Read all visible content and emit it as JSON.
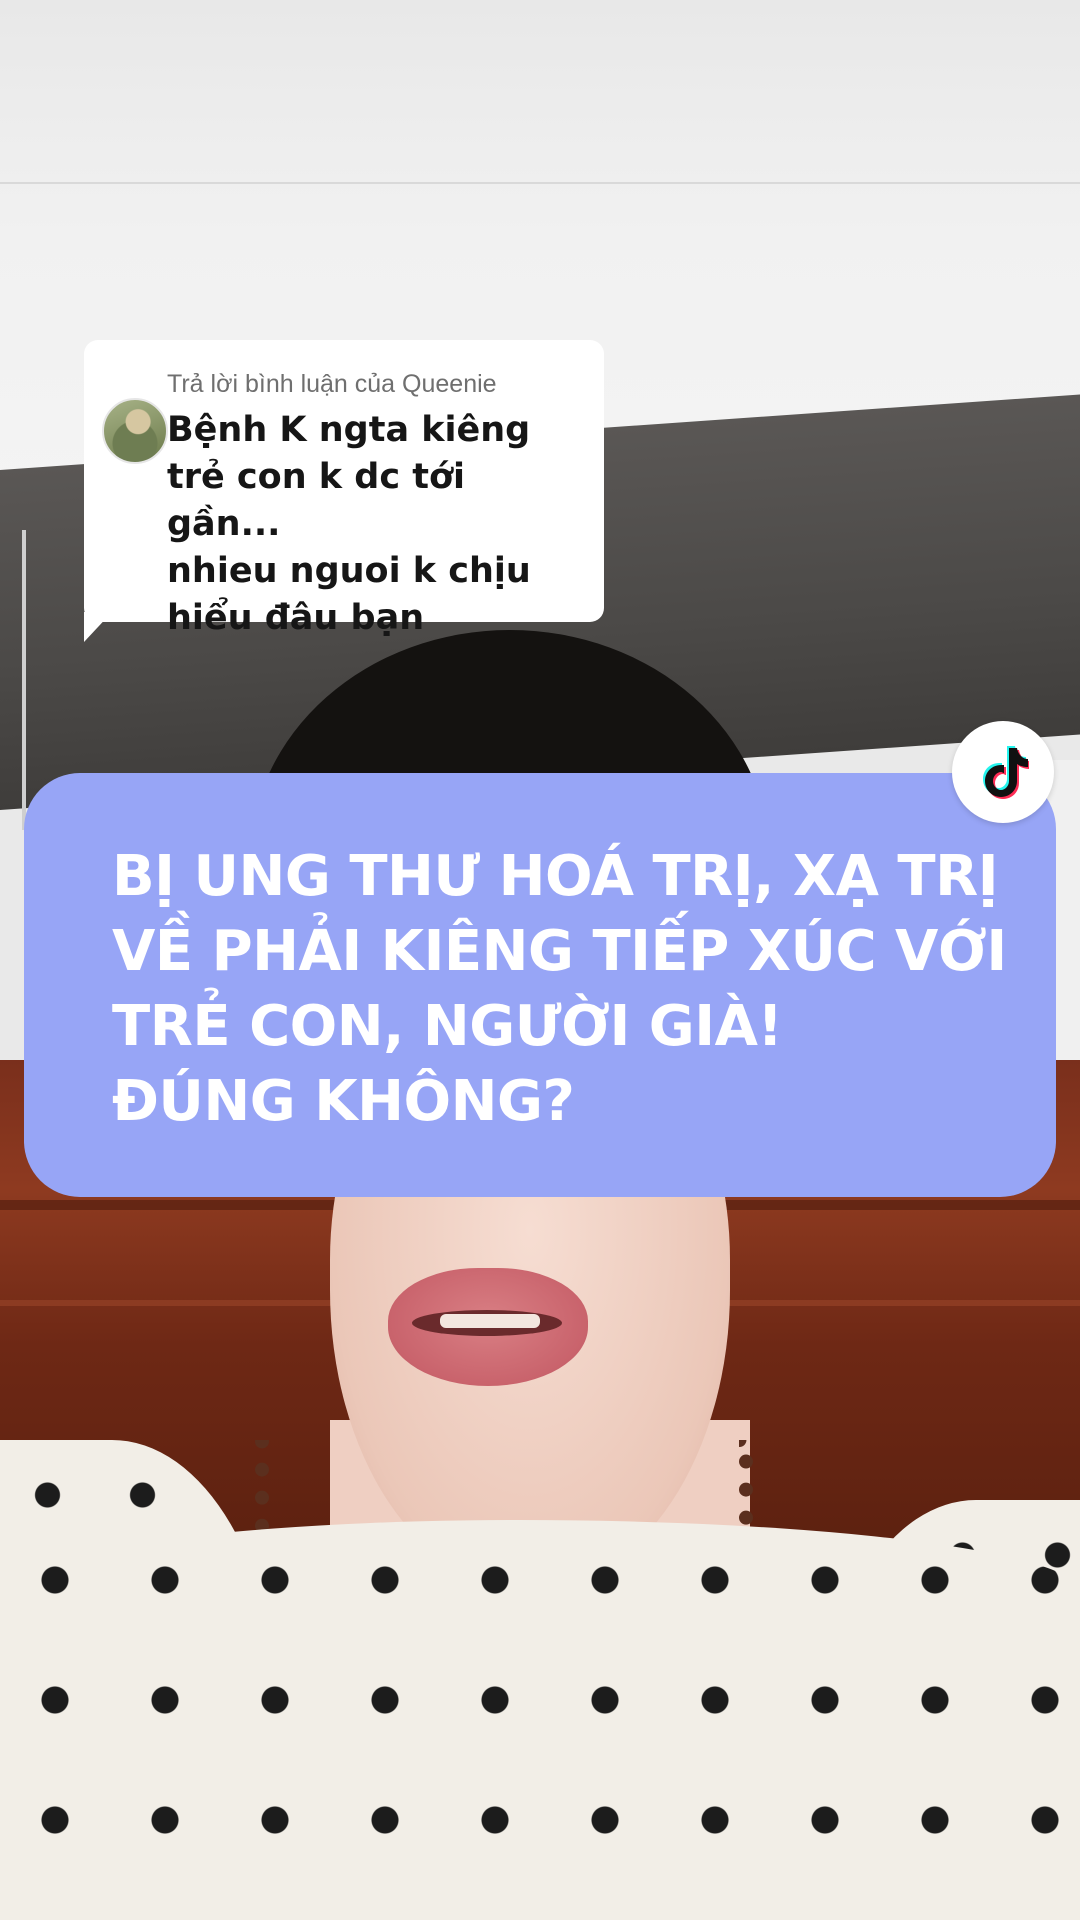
{
  "reply_comment": {
    "header": "Trả lời bình luận của Queenie",
    "text": "Bệnh K ngta kiêng\ntrẻ con k dc tới gần...\nnhieu nguoi k chịu\nhiểu đâu bạn",
    "avatar": "commenter-avatar"
  },
  "headline": {
    "text": "BỊ UNG THƯ HOÁ TRỊ, XẠ TRỊ\nVỀ PHẢI KIÊNG TIẾP XÚC VỚI\nTRẺ CON, NGƯỜI GIÀ!\nĐÚNG KHÔNG?",
    "background_color": "#97a5f6",
    "text_color": "#ffffff"
  },
  "badge": {
    "icon": "tiktok-logo-icon"
  },
  "colors": {
    "bubble_bg": "#ffffff",
    "header_text": "#6f6f6f",
    "comment_text": "#161616"
  }
}
